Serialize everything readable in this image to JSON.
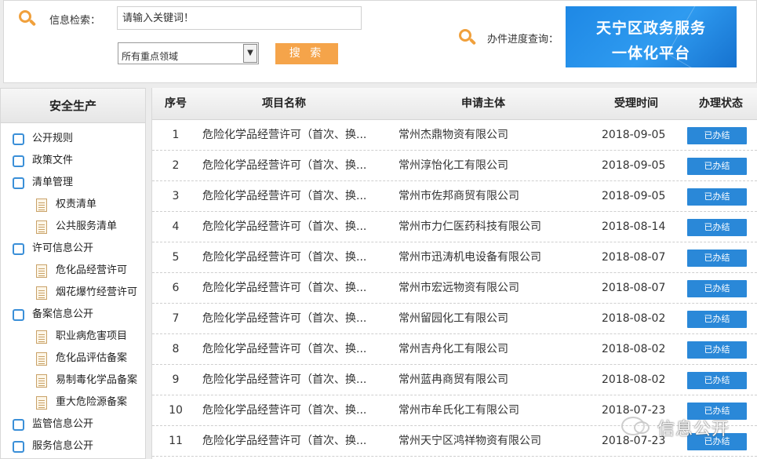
{
  "header": {
    "search_label": "信息检索：",
    "search_placeholder": "请输入关键词！",
    "domain_select_value": "所有重点领域",
    "search_button": "搜 索",
    "progress_label": "办件进度查询：",
    "banner_line1": "天宁区政务服务",
    "banner_line2": "一体化平台"
  },
  "sidebar": {
    "title": "安全生产",
    "items": [
      {
        "label": "公开规则",
        "level": 1
      },
      {
        "label": "政策文件",
        "level": 1
      },
      {
        "label": "清单管理",
        "level": 1
      },
      {
        "label": "权责清单",
        "level": 2
      },
      {
        "label": "公共服务清单",
        "level": 2
      },
      {
        "label": "许可信息公开",
        "level": 1
      },
      {
        "label": "危化品经营许可",
        "level": 2
      },
      {
        "label": "烟花爆竹经营许可",
        "level": 2
      },
      {
        "label": "备案信息公开",
        "level": 1
      },
      {
        "label": "职业病危害项目",
        "level": 2
      },
      {
        "label": "危化品评估备案",
        "level": 2
      },
      {
        "label": "易制毒化学品备案",
        "level": 2
      },
      {
        "label": "重大危险源备案",
        "level": 2
      },
      {
        "label": "监管信息公开",
        "level": 1
      },
      {
        "label": "服务信息公开",
        "level": 1
      }
    ]
  },
  "table": {
    "headers": {
      "no": "序号",
      "name": "项目名称",
      "org": "申请主体",
      "date": "受理时间",
      "status": "办理状态"
    },
    "rows": [
      {
        "no": "1",
        "name": "危险化学品经营许可（首次、换...",
        "org": "常州杰鼎物资有限公司",
        "date": "2018-09-05",
        "status": "已办结"
      },
      {
        "no": "2",
        "name": "危险化学品经营许可（首次、换...",
        "org": "常州淳怡化工有限公司",
        "date": "2018-09-05",
        "status": "已办结"
      },
      {
        "no": "3",
        "name": "危险化学品经营许可（首次、换...",
        "org": "常州市佐邦商贸有限公司",
        "date": "2018-09-05",
        "status": "已办结"
      },
      {
        "no": "4",
        "name": "危险化学品经营许可（首次、换...",
        "org": "常州市力仁医药科技有限公司",
        "date": "2018-08-14",
        "status": "已办结"
      },
      {
        "no": "5",
        "name": "危险化学品经营许可（首次、换...",
        "org": "常州市迅涛机电设备有限公司",
        "date": "2018-08-07",
        "status": "已办结"
      },
      {
        "no": "6",
        "name": "危险化学品经营许可（首次、换...",
        "org": "常州市宏远物资有限公司",
        "date": "2018-08-07",
        "status": "已办结"
      },
      {
        "no": "7",
        "name": "危险化学品经营许可（首次、换...",
        "org": "常州留园化工有限公司",
        "date": "2018-08-02",
        "status": "已办结"
      },
      {
        "no": "8",
        "name": "危险化学品经营许可（首次、换...",
        "org": "常州吉舟化工有限公司",
        "date": "2018-08-02",
        "status": "已办结"
      },
      {
        "no": "9",
        "name": "危险化学品经营许可（首次、换...",
        "org": "常州蓝冉商贸有限公司",
        "date": "2018-08-02",
        "status": "已办结"
      },
      {
        "no": "10",
        "name": "危险化学品经营许可（首次、换...",
        "org": "常州市牟氏化工有限公司",
        "date": "2018-07-23",
        "status": "已办结"
      },
      {
        "no": "11",
        "name": "危险化学品经营许可（首次、换...",
        "org": "常州天宁区鸿祥物资有限公司",
        "date": "2018-07-23",
        "status": "已办结"
      }
    ]
  },
  "watermark": "信息公开",
  "colors": {
    "accent_orange": "#f5a44a",
    "accent_blue": "#2a88d8"
  }
}
